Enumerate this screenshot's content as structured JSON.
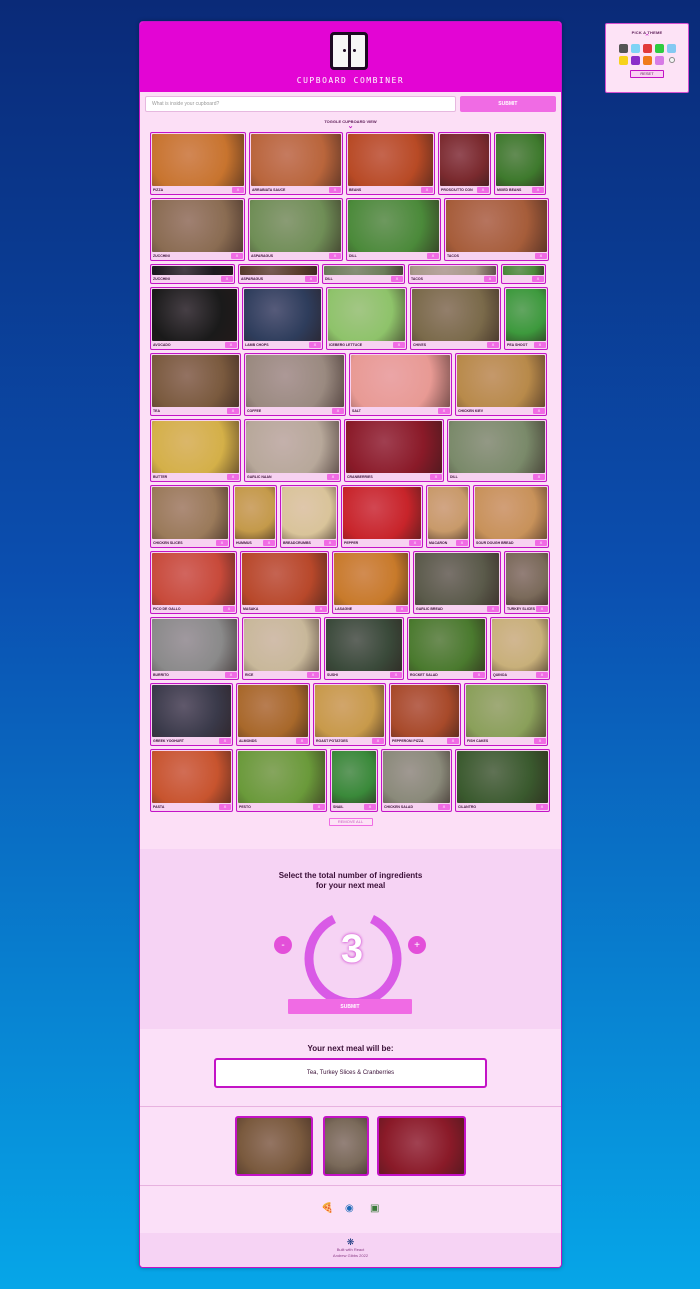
{
  "theme_picker": {
    "title": "PICK A THEME",
    "colors": [
      "#555555",
      "#7fd3f5",
      "#e23a3a",
      "#2ecc40",
      "#84c9f2",
      "#f7d21b",
      "#8a2dc9",
      "#f07a1a",
      "#d77be6",
      "#f4f4f4"
    ],
    "reset_label": "RESET"
  },
  "header": {
    "logo_text": "CUPBOARD COMBINER"
  },
  "search": {
    "placeholder": "What is inside your cupboard?",
    "submit_label": "SUBMIT"
  },
  "toggle_label": "TOGGLE CUPBOARD VIEW",
  "ingredients": [
    [
      {
        "label": "PIZZA",
        "color": "#c8742e"
      },
      {
        "label": "ARRABIATA SAUCE",
        "color": "#b9653b"
      },
      {
        "label": "BEANS",
        "color": "#b84a25"
      },
      {
        "label": "PROSCIUTTO CON",
        "color": "#7a2a2e"
      },
      {
        "label": "MIXED BEANS",
        "color": "#3e7a2d"
      }
    ],
    [
      {
        "label": "ZUCCHINI",
        "color": "#8a6c52"
      },
      {
        "label": "ASPARAGUS",
        "color": "#6f8e56"
      },
      {
        "label": "DILL",
        "color": "#4b8a3a"
      },
      {
        "label": "TACOS",
        "color": "#a65d3a"
      }
    ],
    [
      {
        "label": "ZUCCHINI",
        "color": "#1e1a20"
      },
      {
        "label": "ASPARAGUS",
        "color": "#5a3e2e"
      },
      {
        "label": "DILL",
        "color": "#6c7e5a"
      },
      {
        "label": "TACOS",
        "color": "#a8998a"
      },
      {
        "label": "",
        "color": "#4a8a3a"
      }
    ],
    [
      {
        "label": "AVOCADO",
        "color": "#1a1a1a"
      },
      {
        "label": "LAMB CHOPS",
        "color": "#2e3d5c"
      },
      {
        "label": "ICEBERG LETTUCE",
        "color": "#8ec36a"
      },
      {
        "label": "CHIVES",
        "color": "#7a6a4a"
      },
      {
        "label": "PEA SHOOT",
        "color": "#3d9a3d"
      }
    ],
    [
      {
        "label": "TEA",
        "color": "#7a5a3e"
      },
      {
        "label": "COFFEE",
        "color": "#9a8a80"
      },
      {
        "label": "SALT",
        "color": "#e89a94"
      },
      {
        "label": "CHICKEN KIEV",
        "color": "#b88a4a"
      }
    ],
    [
      {
        "label": "BUTTER",
        "color": "#d4b048"
      },
      {
        "label": "GARLIC NAAN",
        "color": "#b7a89a"
      },
      {
        "label": "CRANBERRIES",
        "color": "#8a1a28"
      },
      {
        "label": "DILL",
        "color": "#7a8a6a"
      }
    ],
    [
      {
        "label": "CHICKEN SLICES",
        "color": "#9a7a5a"
      },
      {
        "label": "HUMMUS",
        "color": "#c49a4a"
      },
      {
        "label": "BREADCRUMBS",
        "color": "#d9c49a"
      },
      {
        "label": "PEPPER",
        "color": "#c8242a"
      },
      {
        "label": "MACARON",
        "color": "#c89a6a"
      },
      {
        "label": "SOUR DOUGH BREAD",
        "color": "#c8925a"
      }
    ],
    [
      {
        "label": "PICO DE GALLO",
        "color": "#c84a3a"
      },
      {
        "label": "MASAKA",
        "color": "#b8482a"
      },
      {
        "label": "LASAGNE",
        "color": "#c87a2a"
      },
      {
        "label": "GARLIC BREAD",
        "color": "#5a5a4a"
      },
      {
        "label": "TURKEY SLICES",
        "color": "#7a6a5a"
      }
    ],
    [
      {
        "label": "BURRITO",
        "color": "#8a8a8a"
      },
      {
        "label": "RICE",
        "color": "#c8b89a"
      },
      {
        "label": "SUSHI",
        "color": "#3a4a3a"
      },
      {
        "label": "ROCKET SALAD",
        "color": "#4a7a2e"
      },
      {
        "label": "QUINOA",
        "color": "#c8b07a"
      }
    ],
    [
      {
        "label": "GREEK YOGHURT",
        "color": "#3a3a4a"
      },
      {
        "label": "ALMONDS",
        "color": "#a8682a"
      },
      {
        "label": "ROAST POTATOES",
        "color": "#c89a4a"
      },
      {
        "label": "PEPPERONI PIZZA",
        "color": "#a84a2a"
      },
      {
        "label": "FISH CAKES",
        "color": "#8aa05a"
      }
    ],
    [
      {
        "label": "PASTA",
        "color": "#c8542e"
      },
      {
        "label": "PESTO",
        "color": "#6a9a3a"
      },
      {
        "label": "SNAIL",
        "color": "#3a8a3a"
      },
      {
        "label": "CHICKEN SALAD",
        "color": "#8a8a7a"
      },
      {
        "label": "CILANTRO",
        "color": "#3a5a2e"
      }
    ]
  ],
  "remove_all_label": "REMOVE ALL",
  "selector": {
    "title_line1": "Select the total number of ingredients",
    "title_line2": "for your next meal",
    "count": "3",
    "minus_label": "-",
    "plus_label": "+",
    "submit_label": "SUBMIT"
  },
  "result": {
    "title": "Your next meal will be:",
    "text": "Tea, Turkey Slices & Cranberries",
    "images": [
      {
        "name": "tea",
        "color": "#7a5a3e"
      },
      {
        "name": "turkey-slices",
        "color": "#7a6a5a"
      },
      {
        "name": "cranberries",
        "color": "#8a1a28"
      }
    ]
  },
  "icons": [
    "pizza-icon",
    "bowl-icon",
    "jar-icon"
  ],
  "footer": {
    "built_with": "Built with React",
    "author": "Andrew Gibbs 2022"
  },
  "accent": "#e305d4"
}
